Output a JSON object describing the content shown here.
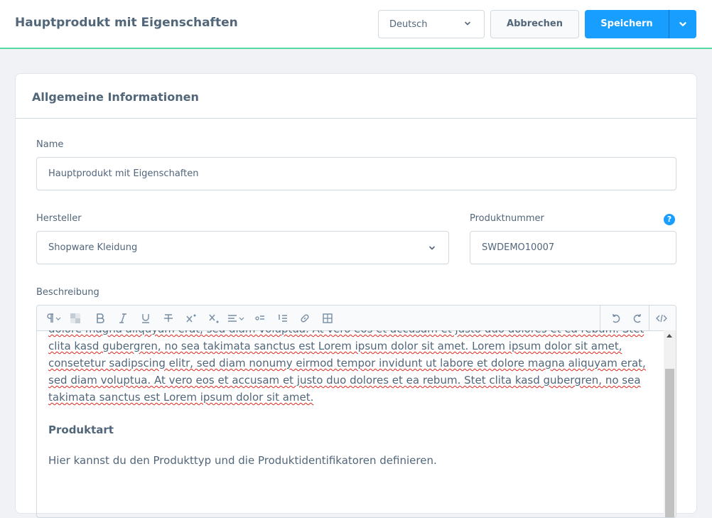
{
  "header": {
    "title": "Hauptprodukt mit Eigenschaften",
    "language": "Deutsch",
    "cancel_label": "Abbrechen",
    "save_label": "Speichern"
  },
  "card": {
    "title": "Allgemeine Informationen",
    "name_label": "Name",
    "name_value": "Hauptprodukt mit Eigenschaften",
    "manufacturer_label": "Hersteller",
    "manufacturer_value": "Shopware Kleidung",
    "product_number_label": "Produktnummer",
    "product_number_value": "SWDEMO10007",
    "help_symbol": "?",
    "description_label": "Beschreibung"
  },
  "editor": {
    "toolbar_icons": [
      "paragraph-icon",
      "clear-format-icon",
      "bold-icon",
      "italic-icon",
      "underline-icon",
      "strikethrough-icon",
      "superscript-icon",
      "subscript-icon",
      "align-icon",
      "bullet-list-icon",
      "numbered-list-icon",
      "link-icon",
      "table-icon",
      "undo-icon",
      "redo-icon",
      "code-view-icon"
    ],
    "text_lines": [
      "dolore magna aliquyam erat, sed diam voluptua. At vero eos et accusam et justo duo dolores et ea rebum. Stet",
      "clita kasd gubergren, no sea takimata sanctus est Lorem ipsum dolor sit amet. Lorem ipsum dolor sit amet,",
      "consetetur sadipscing elitr, sed diam nonumy eirmod tempor invidunt ut labore et dolore magna aliquyam erat,",
      "sed diam voluptua. At vero eos et accusam et justo duo dolores et ea rebum. Stet clita kasd gubergren, no sea",
      "takimata sanctus est Lorem ipsum dolor sit amet."
    ],
    "heading": "Produktart",
    "paragraph": "Hier kannst du den Produkttyp und die Produktidentifikatoren definieren."
  },
  "colors": {
    "accent": "#189eff",
    "header_border": "#57d9a3",
    "text": "#52667a",
    "spellcheck": "#e0261a"
  }
}
